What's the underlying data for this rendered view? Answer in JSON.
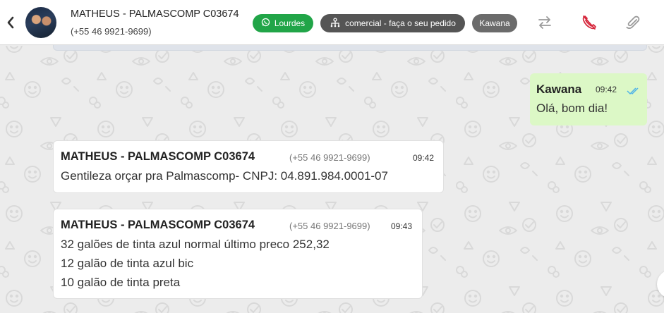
{
  "contact": {
    "name": "MATHEUS - PALMASCOMP C03674",
    "phone": "(+55 46 9921-9699)"
  },
  "tags": {
    "channel": "Lourdes",
    "queue": "comercial - faça o seu pedido",
    "agent": "Kawana"
  },
  "colors": {
    "channel_tag": "#21a548",
    "queue_tag": "#555555",
    "agent_tag": "#6b6b6b",
    "outgoing_bubble": "#dcf8c6",
    "call_icon": "#d6273c",
    "read_ticks": "#4fb3e8"
  },
  "icons": {
    "back": "chevron-left-icon",
    "transfer": "arrows-swap-icon",
    "end_call": "phone-hangup-icon",
    "attach": "paperclip-icon",
    "whatsapp": "whatsapp-icon",
    "queue": "sitemap-icon",
    "ticks": "double-check-icon"
  },
  "messages": [
    {
      "direction": "out",
      "sender": "Kawana",
      "time": "09:42",
      "lines": [
        "Olá, bom dia!"
      ]
    },
    {
      "direction": "in",
      "sender": "MATHEUS - PALMASCOMP C03674",
      "phone": "(+55 46 9921-9699)",
      "time": "09:42",
      "lines": [
        "Gentileza orçar pra Palmascomp- CNPJ: 04.891.984.0001-07"
      ]
    },
    {
      "direction": "in",
      "sender": "MATHEUS - PALMASCOMP C03674",
      "phone": "(+55 46 9921-9699)",
      "time": "09:43",
      "lines": [
        "32 galões de tinta azul normal último preco 252,32",
        "12 galão de tinta azul bic",
        "10 galão de tinta preta"
      ]
    }
  ]
}
